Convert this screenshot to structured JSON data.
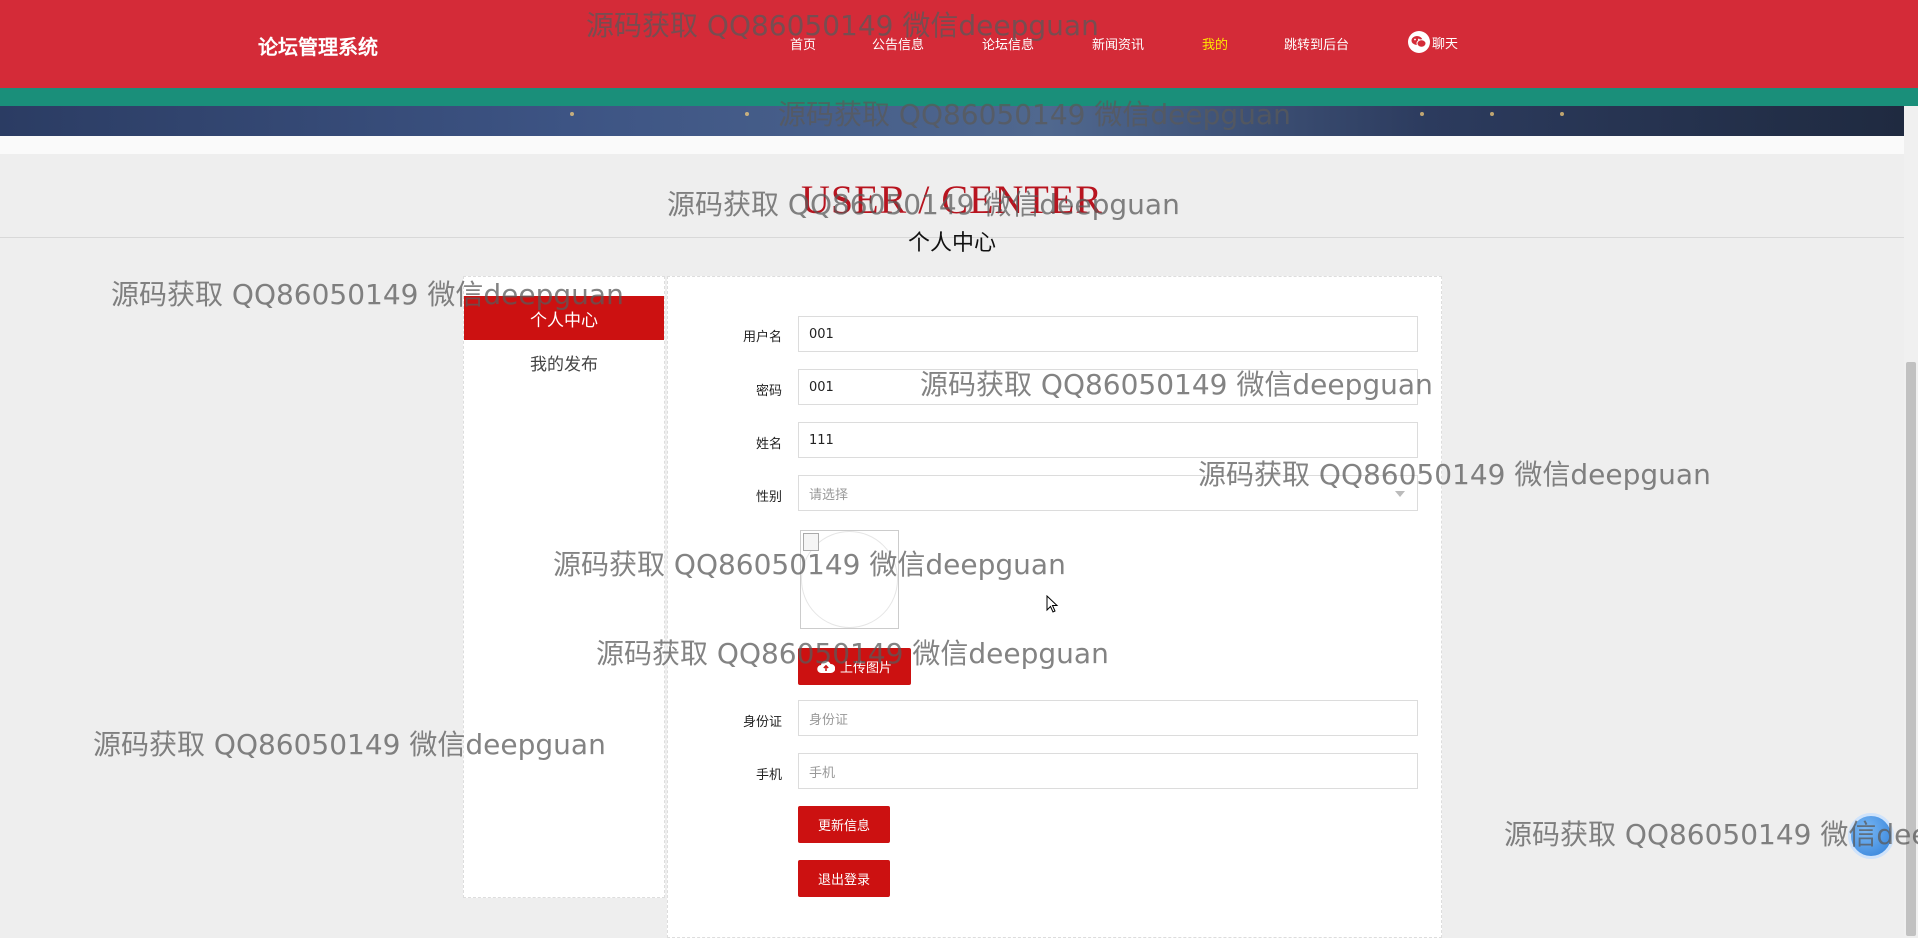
{
  "header": {
    "brand": "论坛管理系统",
    "nav": [
      "首页",
      "公告信息",
      "论坛信息",
      "新闻资讯",
      "我的",
      "跳转到后台"
    ],
    "active_index": 4,
    "chat_label": "聊天"
  },
  "page_title": {
    "en": "USER / CENTER",
    "cn": "个人中心"
  },
  "sidebar": {
    "items": [
      "个人中心",
      "我的发布"
    ],
    "active": "个人中心"
  },
  "form": {
    "username": {
      "label": "用户名",
      "value": "001"
    },
    "password": {
      "label": "密码",
      "value": "001"
    },
    "name": {
      "label": "姓名",
      "value": "111"
    },
    "gender": {
      "label": "性别",
      "placeholder": "请选择"
    },
    "upload_label": "上传图片",
    "id_card": {
      "label": "身份证",
      "placeholder": "身份证"
    },
    "phone": {
      "label": "手机",
      "placeholder": "手机"
    },
    "update_button": "更新信息",
    "logout_button": "退出登录"
  },
  "watermark": "源码获取 QQ86050149 微信deepguan",
  "colors": {
    "header": "#d42b38",
    "accent": "#cc1111",
    "nav_active": "#ffe600",
    "strip": "#1a8f7a"
  }
}
